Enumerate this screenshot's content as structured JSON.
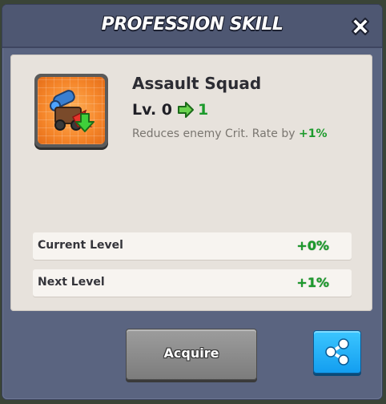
{
  "dialog": {
    "title": "PROFESSION SKILL",
    "close_icon": "close-icon"
  },
  "skill": {
    "icon": "assault-squad-skill-icon",
    "name": "Assault Squad",
    "level_prefix": "Lv. 0",
    "level_next": "1",
    "arrow_icon": "arrow-right-icon",
    "description_prefix": "Reduces enemy Crit. Rate by ",
    "description_value": "+1%"
  },
  "stats": [
    {
      "label": "Current Level",
      "value": "+0%"
    },
    {
      "label": "Next Level",
      "value": "+1%"
    }
  ],
  "buttons": {
    "acquire_label": "Acquire",
    "share_icon": "share-icon"
  },
  "colors": {
    "dialog_bg": "#5a6480",
    "panel_bg": "#e7e2dc",
    "positive_green": "#1c9a2c",
    "share_blue": "#1aa8f5",
    "acquire_gray": "#8c8c8c"
  }
}
